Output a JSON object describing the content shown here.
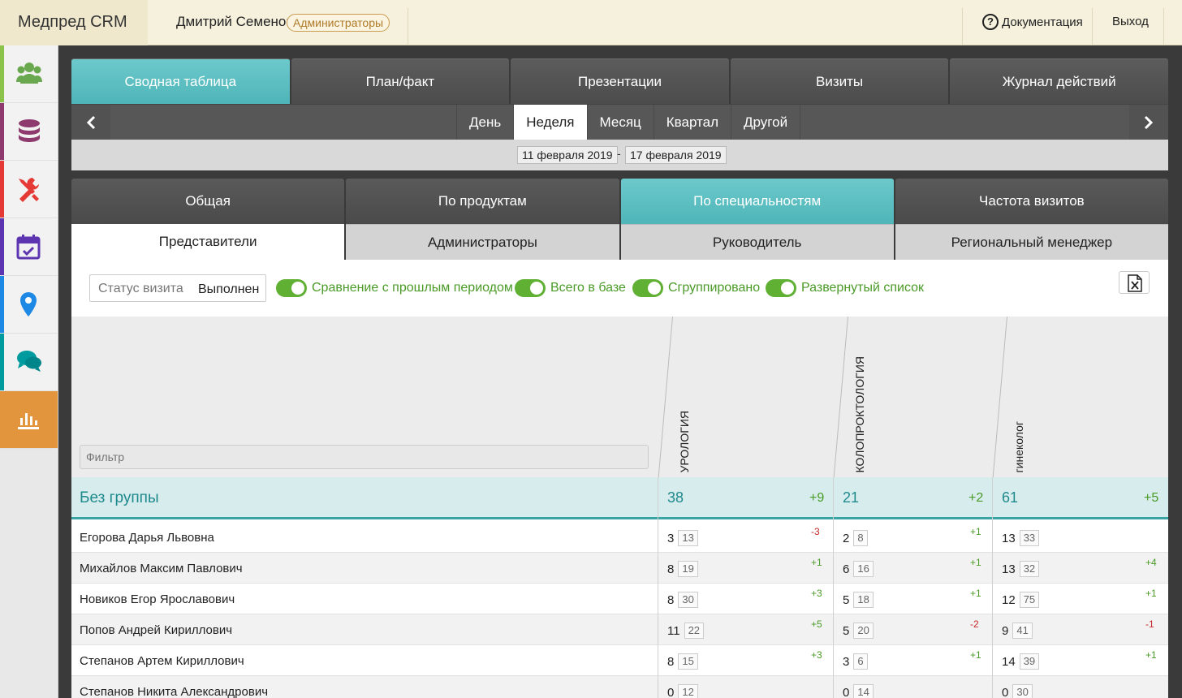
{
  "app": {
    "title": "Медпред CRM"
  },
  "header": {
    "user_name": "Дмитрий Семенов",
    "role_badge": "Администраторы",
    "docs_label": "Документация",
    "exit_label": "Выход"
  },
  "sidebar": {
    "items": [
      {
        "icon": "users-icon",
        "color": "#8bc34a"
      },
      {
        "icon": "database-icon",
        "color": "#8e3a6f"
      },
      {
        "icon": "tools-icon",
        "color": "#e53935"
      },
      {
        "icon": "calendar-check-icon",
        "color": "#5e35b1"
      },
      {
        "icon": "map-pin-icon",
        "color": "#1e88e5"
      },
      {
        "icon": "chat-icon",
        "color": "#009b9e"
      },
      {
        "icon": "bar-chart-icon",
        "color": "#e3953e",
        "active": true
      }
    ]
  },
  "main_tabs": [
    "Сводная таблица",
    "План/факт",
    "Презентации",
    "Визиты",
    "Журнал действий"
  ],
  "period": {
    "items": [
      "День",
      "Неделя",
      "Месяц",
      "Квартал",
      "Другой"
    ],
    "active": "Неделя",
    "date_from": "11 февраля 2019",
    "date_sep": "-",
    "date_to": "17 февраля 2019"
  },
  "report_tabs": [
    "Общая",
    "По продуктам",
    "По специальностям",
    "Частота визитов"
  ],
  "sub_tabs": [
    "Представители",
    "Администраторы",
    "Руководитель",
    "Региональный менеджер"
  ],
  "filters": {
    "status_label": "Статус визита",
    "status_value": "Выполнен",
    "toggles": [
      "Сравнение с прошлым периодом",
      "Всего в базе",
      "Сгруппировано",
      "Развернутый список"
    ],
    "filter_placeholder": "Фильтр",
    "export_icon": "excel-icon"
  },
  "table": {
    "columns": [
      "УРОЛОГИЯ",
      "КОЛОПРОКТОЛОГИЯ",
      "гинеколог"
    ],
    "group": {
      "name": "Без группы",
      "values": [
        {
          "value": "38",
          "diff": "+9"
        },
        {
          "value": "21",
          "diff": "+2"
        },
        {
          "value": "61",
          "diff": "+5"
        }
      ]
    },
    "rows": [
      {
        "name": "Егорова Дарья Львовна",
        "cells": [
          {
            "v": "3",
            "p": "13",
            "d": "-3"
          },
          {
            "v": "2",
            "p": "8",
            "d": "+1"
          },
          {
            "v": "13",
            "p": "33",
            "d": ""
          }
        ]
      },
      {
        "name": "Михайлов Максим Павлович",
        "cells": [
          {
            "v": "8",
            "p": "19",
            "d": "+1"
          },
          {
            "v": "6",
            "p": "16",
            "d": "+1"
          },
          {
            "v": "13",
            "p": "32",
            "d": "+4"
          }
        ]
      },
      {
        "name": "Новиков Егор Ярославович",
        "cells": [
          {
            "v": "8",
            "p": "30",
            "d": "+3"
          },
          {
            "v": "5",
            "p": "18",
            "d": "+1"
          },
          {
            "v": "12",
            "p": "75",
            "d": "+1"
          }
        ]
      },
      {
        "name": "Попов Андрей Кириллович",
        "cells": [
          {
            "v": "11",
            "p": "22",
            "d": "+5"
          },
          {
            "v": "5",
            "p": "20",
            "d": "-2"
          },
          {
            "v": "9",
            "p": "41",
            "d": "-1"
          }
        ]
      },
      {
        "name": "Степанов Артем Кириллович",
        "cells": [
          {
            "v": "8",
            "p": "15",
            "d": "+3"
          },
          {
            "v": "3",
            "p": "6",
            "d": "+1"
          },
          {
            "v": "14",
            "p": "39",
            "d": "+1"
          }
        ]
      },
      {
        "name": "Степанов Никита Александрович",
        "cells": [
          {
            "v": "0",
            "p": "12",
            "d": ""
          },
          {
            "v": "0",
            "p": "14",
            "d": ""
          },
          {
            "v": "0",
            "p": "30",
            "d": ""
          }
        ]
      }
    ]
  }
}
